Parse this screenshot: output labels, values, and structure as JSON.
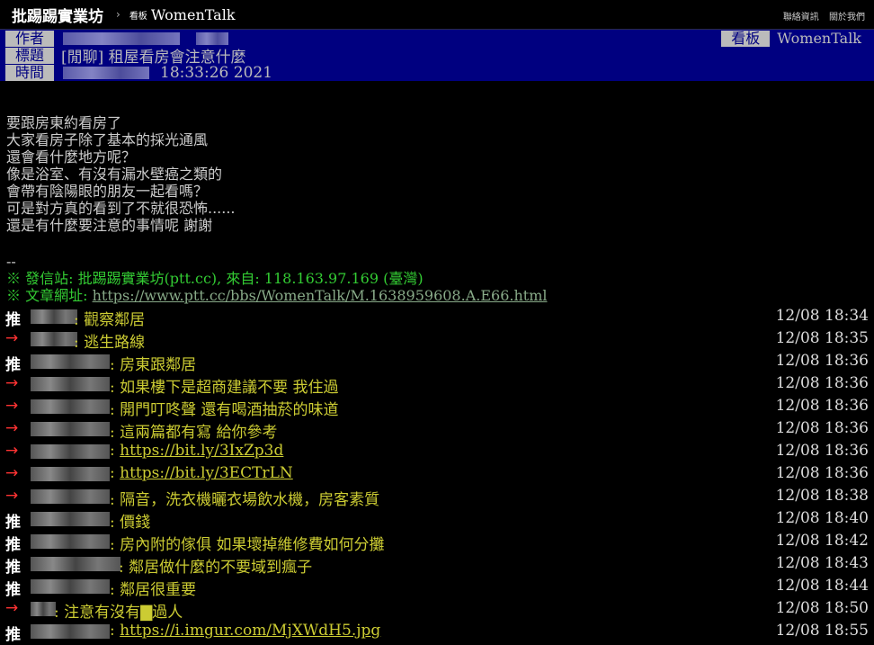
{
  "topbar": {
    "site": "批踢踢實業坊",
    "sep": "›",
    "board_label": "看板",
    "board_name": "WomenTalk",
    "links": [
      "聯絡資訊",
      "關於我們"
    ]
  },
  "header": {
    "author_label": "作者",
    "title_label": "標題",
    "time_label": "時間",
    "board_label": "看板",
    "board_name": "WomenTalk",
    "title": "[閒聊] 租屋看房會注意什麼",
    "time": "18:33:26 2021"
  },
  "body_lines": [
    "要跟房東約看房了",
    "大家看房子除了基本的採光通風",
    "還會看什麼地方呢？",
    "像是浴室、有沒有漏水壁癌之類的",
    "會帶有陰陽眼的朋友一起看嗎？",
    "可是對方真的看到了不就很恐怖......",
    "還是有什麼要注意的事情呢 謝謝"
  ],
  "footer": {
    "dashes": "--",
    "sent_from": "※ 發信站: 批踢踢實業坊(ptt.cc), 來自: 118.163.97.169 (臺灣)",
    "url_label": "※ 文章網址: ",
    "url": "https://www.ptt.cc/bbs/WomenTalk/M.1638959608.A.E66.html"
  },
  "pushes": [
    {
      "tag": "推",
      "type": "good",
      "content": "觀察鄰居",
      "time": "12/08 18:34"
    },
    {
      "tag": "→",
      "type": "arrow",
      "content": "逃生路線",
      "time": "12/08 18:35"
    },
    {
      "tag": "推",
      "type": "good",
      "content": "房東跟鄰居",
      "time": "12/08 18:36"
    },
    {
      "tag": "→",
      "type": "arrow",
      "content": "如果樓下是超商建議不要 我住過",
      "time": "12/08 18:36"
    },
    {
      "tag": "→",
      "type": "arrow",
      "content": "開門叮咚聲 還有喝酒抽菸的味道",
      "time": "12/08 18:36"
    },
    {
      "tag": "→",
      "type": "arrow",
      "content": "這兩篇都有寫 給你參考",
      "time": "12/08 18:36"
    },
    {
      "tag": "→",
      "type": "arrow",
      "content": "https://bit.ly/3IxZp3d",
      "time": "12/08 18:36",
      "link": true
    },
    {
      "tag": "→",
      "type": "arrow",
      "content": "https://bit.ly/3ECTrLN",
      "time": "12/08 18:36",
      "link": true
    },
    {
      "tag": "→",
      "type": "arrow",
      "content": "隔音，洗衣機曬衣場飲水機，房客素質",
      "time": "12/08 18:38"
    },
    {
      "tag": "推",
      "type": "good",
      "content": "價錢",
      "time": "12/08 18:40"
    },
    {
      "tag": "推",
      "type": "good",
      "content": "房內附的傢俱 如果壞掉維修費如何分攤",
      "time": "12/08 18:42"
    },
    {
      "tag": "推",
      "type": "good",
      "content": "鄰居做什麼的不要域到瘋子",
      "time": "12/08 18:43"
    },
    {
      "tag": "推",
      "type": "good",
      "content": "鄰居很重要",
      "time": "12/08 18:44"
    },
    {
      "tag": "→",
      "type": "arrow",
      "content": "注意有沒有▇過人",
      "time": "12/08 18:50"
    },
    {
      "tag": "推",
      "type": "good",
      "content": "https://i.imgur.com/MjXWdH5.jpg",
      "time": "12/08 18:55",
      "link": true
    }
  ]
}
